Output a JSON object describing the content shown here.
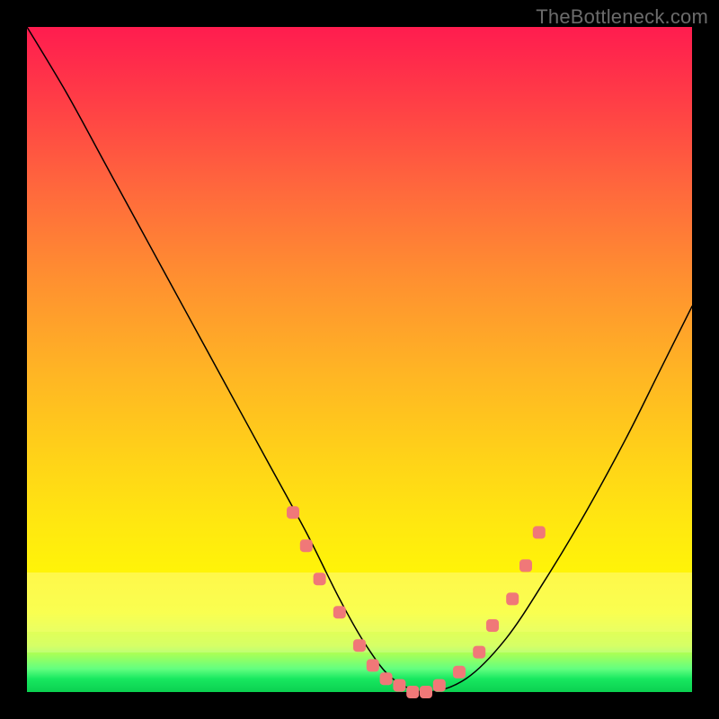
{
  "watermark": "TheBottleneck.com",
  "chart_data": {
    "type": "line",
    "title": "",
    "xlabel": "",
    "ylabel": "",
    "xlim": [
      0,
      100
    ],
    "ylim": [
      0,
      100
    ],
    "grid": false,
    "legend": false,
    "background_gradient": {
      "orientation": "vertical",
      "stops": [
        {
          "pos": 0,
          "color": "#ff1c4f"
        },
        {
          "pos": 25,
          "color": "#ff6a3c"
        },
        {
          "pos": 52,
          "color": "#ffb524"
        },
        {
          "pos": 75,
          "color": "#ffe810"
        },
        {
          "pos": 93,
          "color": "#d0ff40"
        },
        {
          "pos": 100,
          "color": "#0bd050"
        }
      ]
    },
    "series": [
      {
        "name": "bottleneck-curve",
        "type": "line",
        "color": "#000000",
        "width": 1.5,
        "x": [
          0,
          6,
          12,
          18,
          24,
          30,
          36,
          42,
          47,
          51,
          55,
          60,
          66,
          72,
          78,
          84,
          90,
          95,
          100
        ],
        "y": [
          100,
          90,
          79,
          68,
          57,
          46,
          35,
          24,
          14,
          7,
          2,
          0,
          2,
          8,
          17,
          27,
          38,
          48,
          58
        ]
      },
      {
        "name": "highlight-dots",
        "type": "scatter",
        "color": "#f07878",
        "marker": "rounded-square",
        "size": 14,
        "x": [
          40,
          42,
          44,
          47,
          50,
          52,
          54,
          56,
          58,
          60,
          62,
          65,
          68,
          70,
          73,
          75,
          77
        ],
        "y": [
          27,
          22,
          17,
          12,
          7,
          4,
          2,
          1,
          0,
          0,
          1,
          3,
          6,
          10,
          14,
          19,
          24
        ]
      }
    ],
    "annotations": []
  }
}
